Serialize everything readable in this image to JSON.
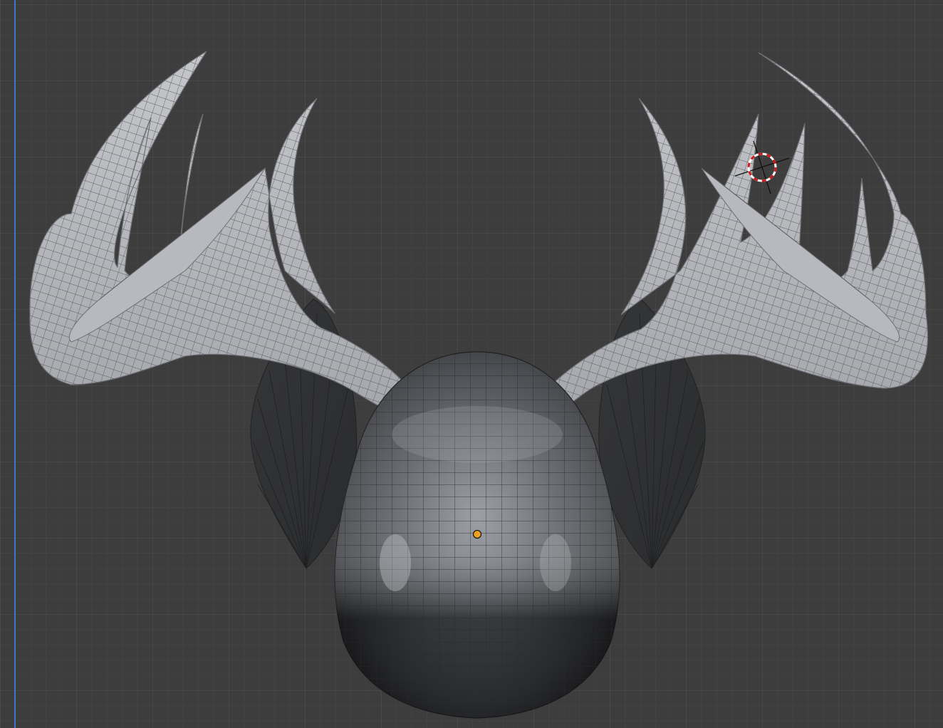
{
  "viewport": {
    "view": "3D Viewport",
    "background_color": "#3d3d3d",
    "grid_minor_color": "#474747",
    "grid_major_color": "#525252",
    "axis_color": "#3a78c8",
    "show_grid": true,
    "shading": "solid"
  },
  "scene": {
    "objects": [
      {
        "name": "antler-left",
        "material": "light-grey-wireframe"
      },
      {
        "name": "antler-right",
        "material": "light-grey-wireframe"
      },
      {
        "name": "ear-left",
        "material": "dark-grey"
      },
      {
        "name": "ear-right",
        "material": "dark-grey"
      },
      {
        "name": "head",
        "material": "metallic-dark-grey"
      }
    ],
    "origin_marker_color": "#f0a020",
    "cursor_colors": [
      "#ffffff",
      "#d01818"
    ]
  }
}
